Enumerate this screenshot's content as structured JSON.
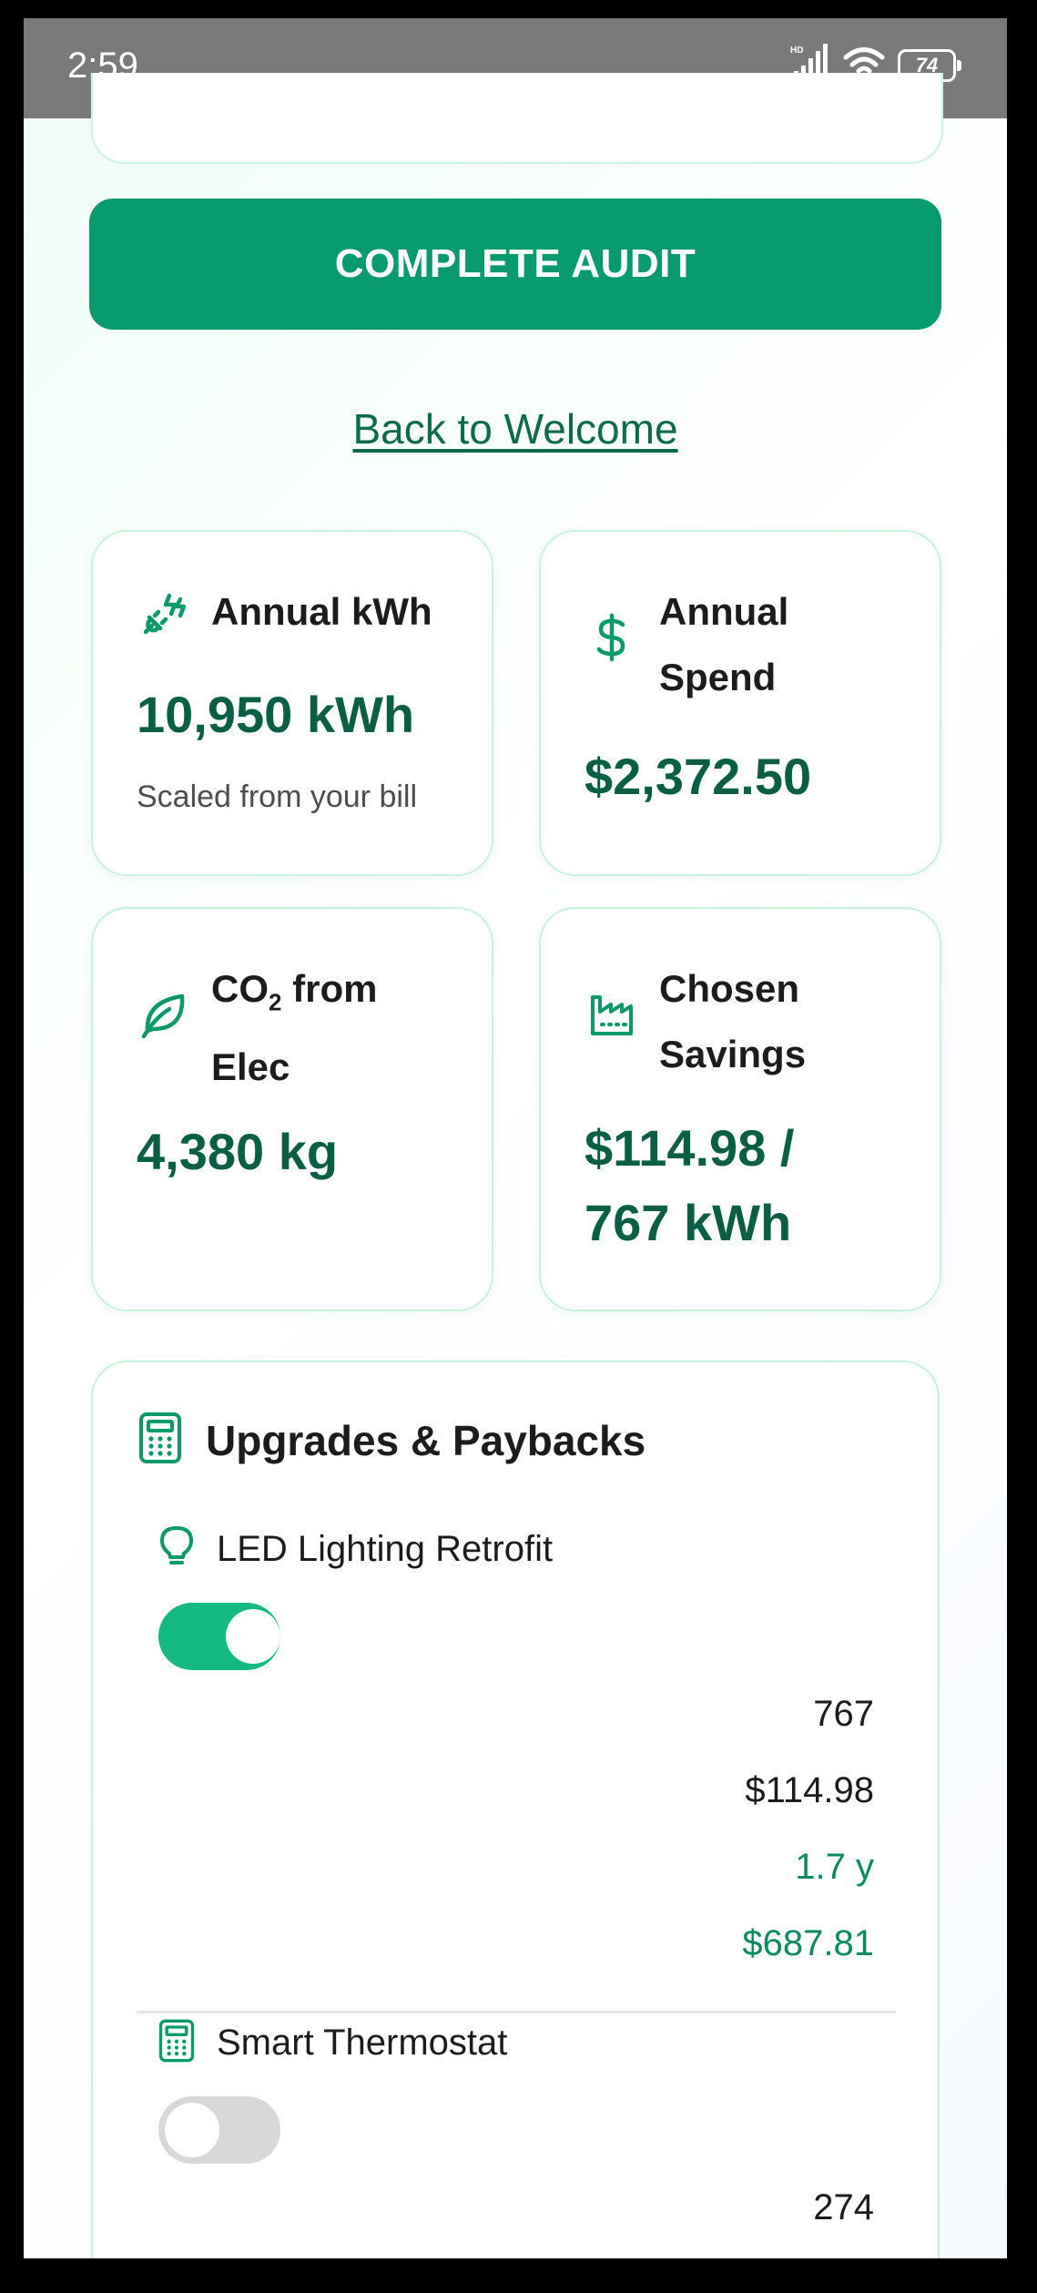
{
  "status": {
    "time": "2:59",
    "battery": "74",
    "network": "HD"
  },
  "actions": {
    "complete_audit": "COMPLETE AUDIT",
    "back_to_welcome": "Back to Welcome"
  },
  "stats": [
    {
      "title": "Annual kWh",
      "value": "10,950 kWh",
      "sub": "Scaled from your bill",
      "icon": "plug-icon"
    },
    {
      "title_line1": "Annual",
      "title_line2": "Spend",
      "value": "$2,372.50",
      "icon": "dollar-icon"
    },
    {
      "title_line1_pre": "CO",
      "title_line1_sub": "2",
      "title_line1_post": " from",
      "title_line2": "Elec",
      "value": "4,380 kg",
      "icon": "leaf-icon"
    },
    {
      "title_line1": "Chosen",
      "title_line2": "Savings",
      "value_line1": "$114.98 /",
      "value_line2": "767 kWh",
      "icon": "factory-icon"
    }
  ],
  "upgrades": {
    "title": "Upgrades & Paybacks",
    "items": [
      {
        "name": "LED Lighting Retrofit",
        "enabled": true,
        "kwh": "767",
        "savings": "$114.98",
        "payback": "1.7 y",
        "net": "$687.81",
        "icon": "lightbulb-icon"
      },
      {
        "name": "Smart Thermostat",
        "enabled": false,
        "kwh": "274",
        "icon": "calculator-icon"
      }
    ]
  },
  "colors": {
    "primary": "#079a6c",
    "accent": "#14ba7f",
    "value_text": "#0a5e43",
    "card_border": "#c9f2de"
  }
}
